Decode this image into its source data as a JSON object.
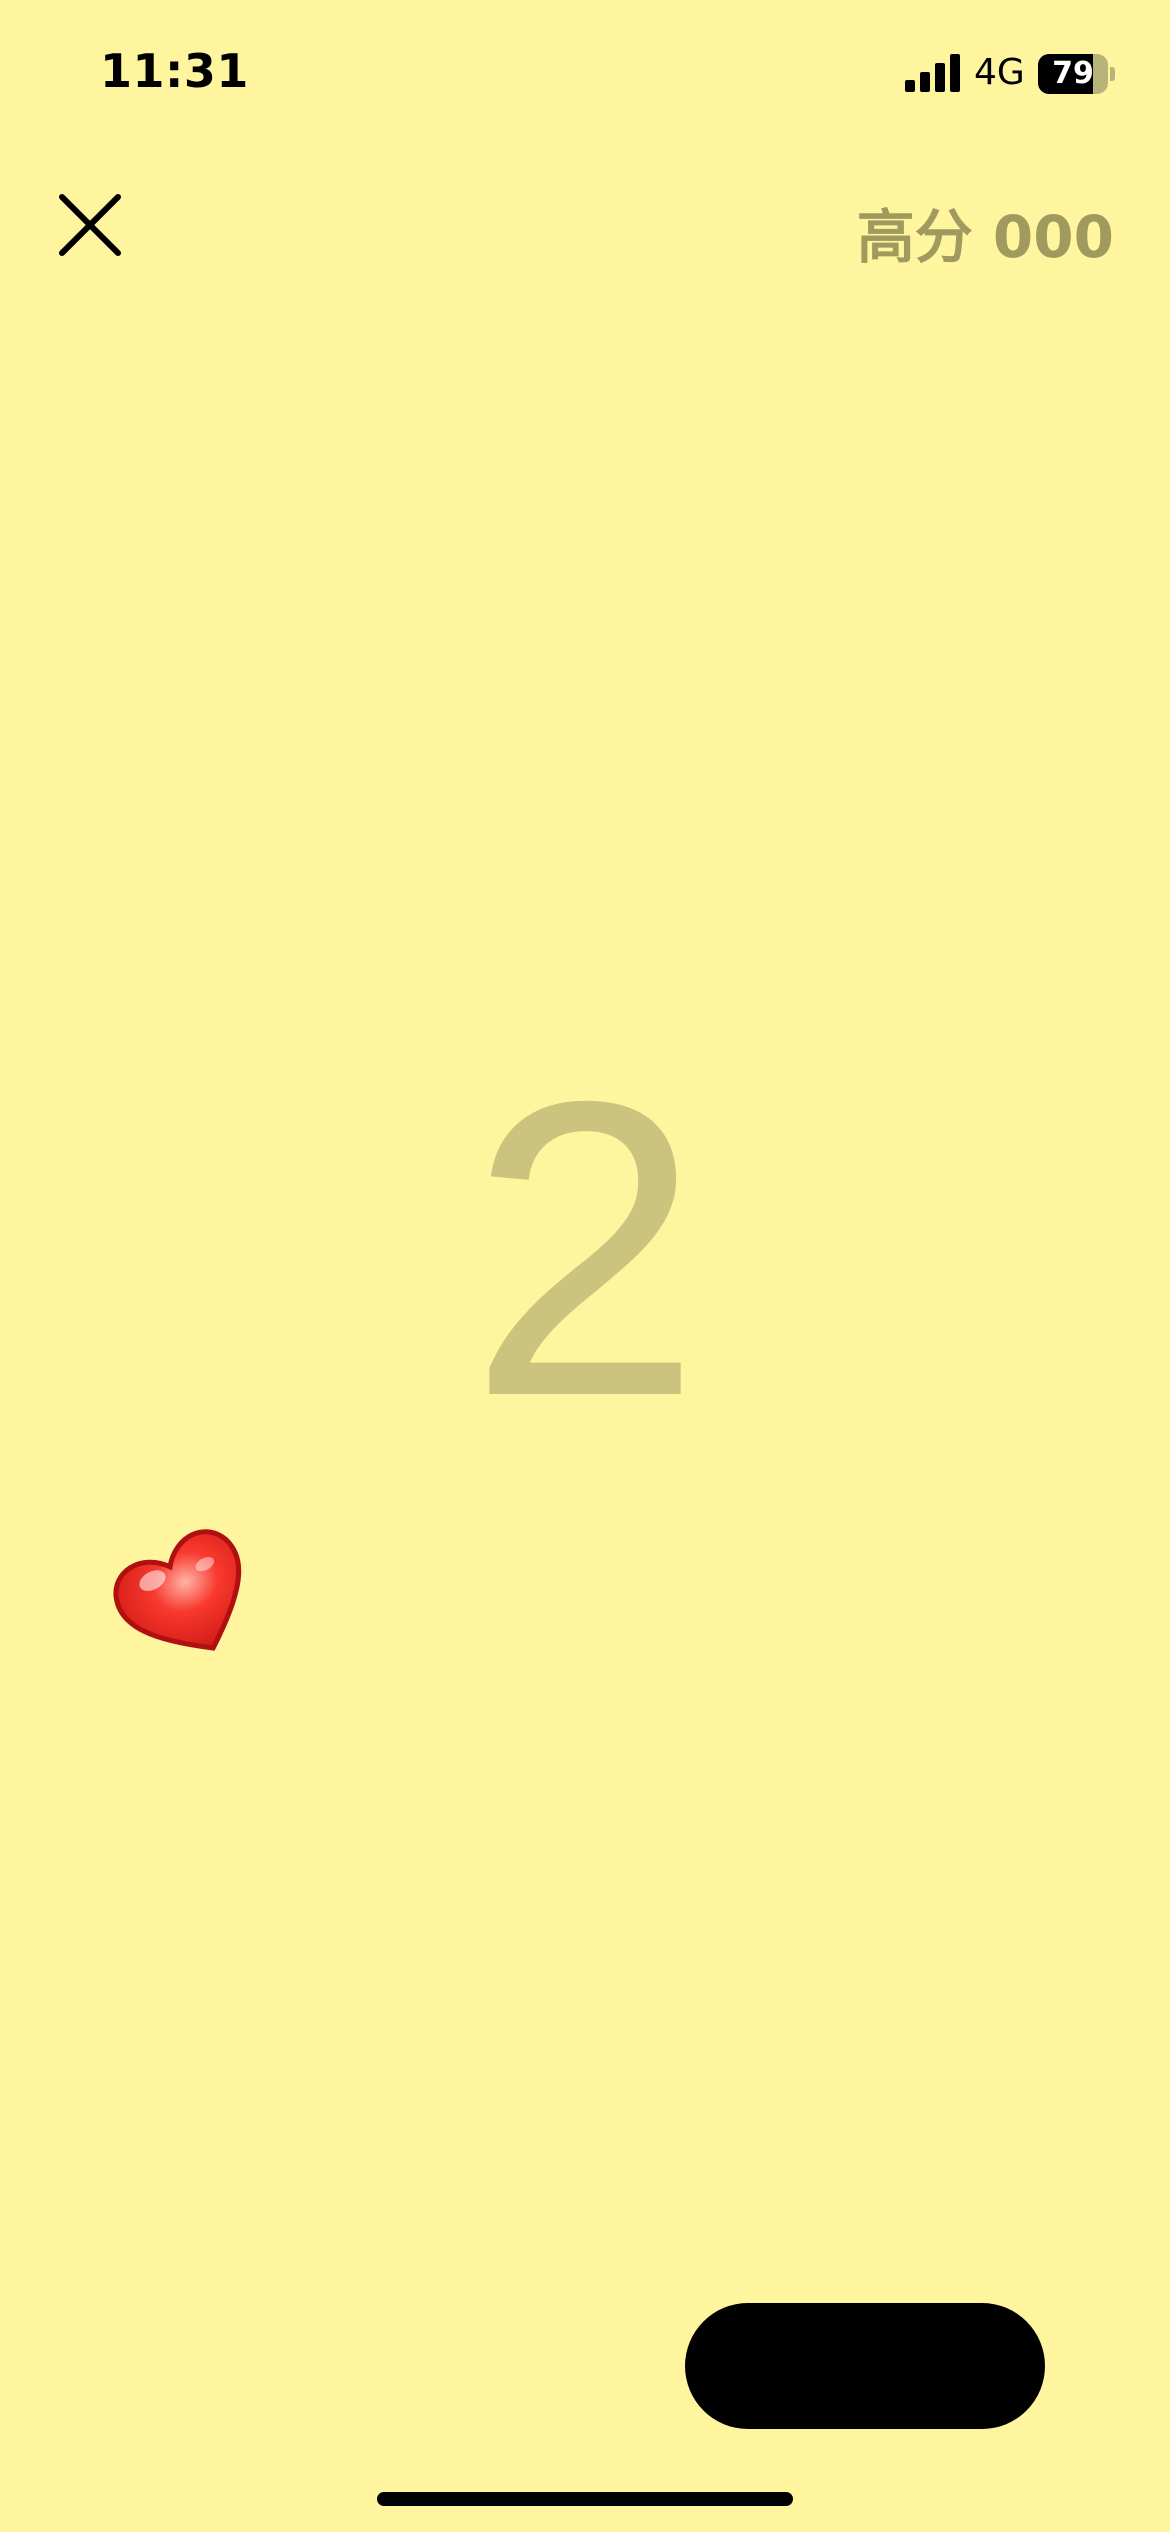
{
  "status_bar": {
    "time": "11:31",
    "network": "4G",
    "battery_level": "79",
    "battery_fraction": 0.79,
    "signal_bars": 4
  },
  "icons": {
    "close": "close-icon",
    "heart": "heart-icon",
    "signal": "signal-icon",
    "battery": "battery-icon"
  },
  "header": {
    "high_score": "高分 000"
  },
  "game": {
    "countdown": "2"
  },
  "colors": {
    "background": "#FFF59F",
    "countdown": "#CCC47E",
    "high_score": "#A09A5E",
    "heart": "#E8231C",
    "paddle": "#000000"
  }
}
